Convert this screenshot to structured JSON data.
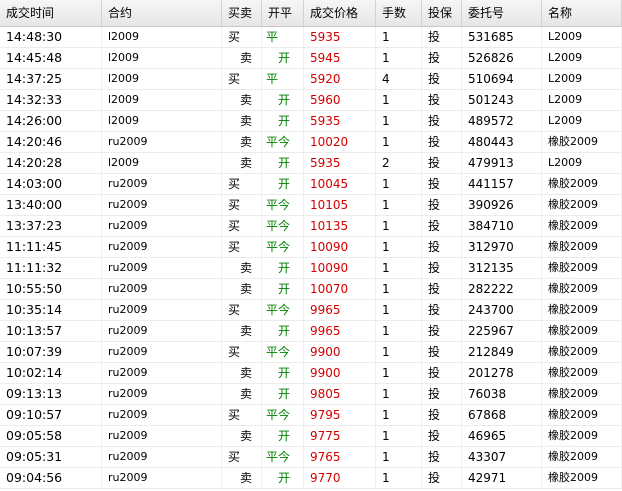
{
  "headers": [
    "成交时间",
    "合约",
    "买卖",
    "开平",
    "成交价格",
    "手数",
    "投保",
    "委托号",
    "名称"
  ],
  "rows": [
    {
      "time": "14:48:30",
      "contract": "l2009",
      "side": "买",
      "kp": "平",
      "price": "5935",
      "lots": "1",
      "hedge": "投",
      "order": "531685",
      "name": "L2009"
    },
    {
      "time": "14:45:48",
      "contract": "l2009",
      "side": "卖",
      "kp": "开",
      "price": "5945",
      "lots": "1",
      "hedge": "投",
      "order": "526826",
      "name": "L2009"
    },
    {
      "time": "14:37:25",
      "contract": "l2009",
      "side": "买",
      "kp": "平",
      "price": "5920",
      "lots": "4",
      "hedge": "投",
      "order": "510694",
      "name": "L2009"
    },
    {
      "time": "14:32:33",
      "contract": "l2009",
      "side": "卖",
      "kp": "开",
      "price": "5960",
      "lots": "1",
      "hedge": "投",
      "order": "501243",
      "name": "L2009"
    },
    {
      "time": "14:26:00",
      "contract": "l2009",
      "side": "卖",
      "kp": "开",
      "price": "5935",
      "lots": "1",
      "hedge": "投",
      "order": "489572",
      "name": "L2009"
    },
    {
      "time": "14:20:46",
      "contract": "ru2009",
      "side": "卖",
      "kp": "平今",
      "price": "10020",
      "lots": "1",
      "hedge": "投",
      "order": "480443",
      "name": "橡胶2009"
    },
    {
      "time": "14:20:28",
      "contract": "l2009",
      "side": "卖",
      "kp": "开",
      "price": "5935",
      "lots": "2",
      "hedge": "投",
      "order": "479913",
      "name": "L2009"
    },
    {
      "time": "14:03:00",
      "contract": "ru2009",
      "side": "买",
      "kp": "开",
      "price": "10045",
      "lots": "1",
      "hedge": "投",
      "order": "441157",
      "name": "橡胶2009"
    },
    {
      "time": "13:40:00",
      "contract": "ru2009",
      "side": "买",
      "kp": "平今",
      "price": "10105",
      "lots": "1",
      "hedge": "投",
      "order": "390926",
      "name": "橡胶2009"
    },
    {
      "time": "13:37:23",
      "contract": "ru2009",
      "side": "买",
      "kp": "平今",
      "price": "10135",
      "lots": "1",
      "hedge": "投",
      "order": "384710",
      "name": "橡胶2009"
    },
    {
      "time": "11:11:45",
      "contract": "ru2009",
      "side": "买",
      "kp": "平今",
      "price": "10090",
      "lots": "1",
      "hedge": "投",
      "order": "312970",
      "name": "橡胶2009"
    },
    {
      "time": "11:11:32",
      "contract": "ru2009",
      "side": "卖",
      "kp": "开",
      "price": "10090",
      "lots": "1",
      "hedge": "投",
      "order": "312135",
      "name": "橡胶2009"
    },
    {
      "time": "10:55:50",
      "contract": "ru2009",
      "side": "卖",
      "kp": "开",
      "price": "10070",
      "lots": "1",
      "hedge": "投",
      "order": "282222",
      "name": "橡胶2009"
    },
    {
      "time": "10:35:14",
      "contract": "ru2009",
      "side": "买",
      "kp": "平今",
      "price": "9965",
      "lots": "1",
      "hedge": "投",
      "order": "243700",
      "name": "橡胶2009"
    },
    {
      "time": "10:13:57",
      "contract": "ru2009",
      "side": "卖",
      "kp": "开",
      "price": "9965",
      "lots": "1",
      "hedge": "投",
      "order": "225967",
      "name": "橡胶2009"
    },
    {
      "time": "10:07:39",
      "contract": "ru2009",
      "side": "买",
      "kp": "平今",
      "price": "9900",
      "lots": "1",
      "hedge": "投",
      "order": "212849",
      "name": "橡胶2009"
    },
    {
      "time": "10:02:14",
      "contract": "ru2009",
      "side": "卖",
      "kp": "开",
      "price": "9900",
      "lots": "1",
      "hedge": "投",
      "order": "201278",
      "name": "橡胶2009"
    },
    {
      "time": "09:13:13",
      "contract": "ru2009",
      "side": "卖",
      "kp": "开",
      "price": "9805",
      "lots": "1",
      "hedge": "投",
      "order": "76038",
      "name": "橡胶2009"
    },
    {
      "time": "09:10:57",
      "contract": "ru2009",
      "side": "买",
      "kp": "平今",
      "price": "9795",
      "lots": "1",
      "hedge": "投",
      "order": "67868",
      "name": "橡胶2009"
    },
    {
      "time": "09:05:58",
      "contract": "ru2009",
      "side": "卖",
      "kp": "开",
      "price": "9775",
      "lots": "1",
      "hedge": "投",
      "order": "46965",
      "name": "橡胶2009"
    },
    {
      "time": "09:05:31",
      "contract": "ru2009",
      "side": "买",
      "kp": "平今",
      "price": "9765",
      "lots": "1",
      "hedge": "投",
      "order": "43307",
      "name": "橡胶2009"
    },
    {
      "time": "09:04:56",
      "contract": "ru2009",
      "side": "卖",
      "kp": "开",
      "price": "9770",
      "lots": "1",
      "hedge": "投",
      "order": "42971",
      "name": "橡胶2009"
    }
  ],
  "colors": {
    "price": "#d40000",
    "kp": "#008000"
  }
}
